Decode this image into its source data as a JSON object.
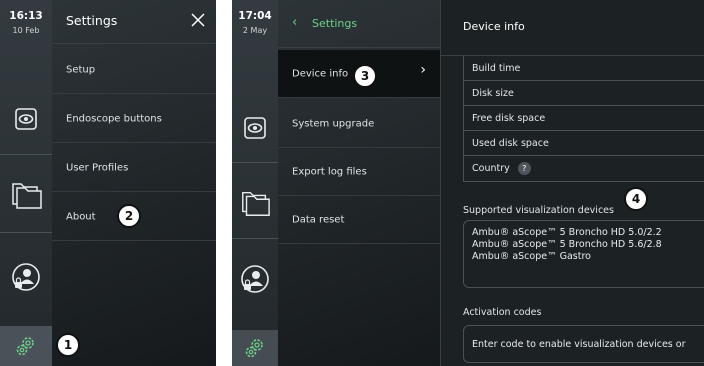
{
  "screen_a": {
    "time": "16:13",
    "date": "10 Feb",
    "menu_title": "Settings",
    "close_icon": "close-icon",
    "menu_items": [
      {
        "label": "Setup"
      },
      {
        "label": "Endoscope buttons"
      },
      {
        "label": "User Profiles"
      },
      {
        "label": "About"
      }
    ],
    "rail_icons": [
      "eye-icon",
      "folders-icon",
      "user-lock-icon",
      "gear-icon"
    ],
    "callouts": [
      "2",
      "1"
    ]
  },
  "screen_b": {
    "time": "17:04",
    "date": "2 May",
    "back_label": "Settings",
    "menu_items": [
      {
        "label": "Device info",
        "active": true
      },
      {
        "label": "System upgrade"
      },
      {
        "label": "Export log files"
      },
      {
        "label": "Data reset"
      }
    ],
    "detail": {
      "title": "Device info",
      "rows": [
        {
          "label": "Build time"
        },
        {
          "label": "Disk size"
        },
        {
          "label": "Free disk space"
        },
        {
          "label": "Used disk space"
        },
        {
          "label": "Country",
          "help": "?"
        }
      ],
      "supported_label": "Supported visualization devices",
      "devices": [
        "Ambu® aScope™ 5 Broncho HD 5.0/2.2",
        "Ambu® aScope™ 5 Broncho HD 5.6/2.8",
        "Ambu® aScope™ Gastro"
      ],
      "activation_label": "Activation codes",
      "activation_placeholder": "Enter code to enable visualization devices or"
    },
    "callouts": [
      "3",
      "4"
    ]
  },
  "colors": {
    "accent_green": "#6fd08c",
    "background": "#1e2326",
    "text": "#e3e7e9"
  }
}
